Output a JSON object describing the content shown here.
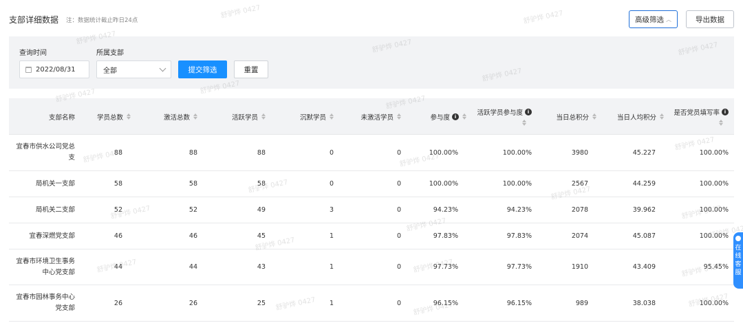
{
  "header": {
    "title": "支部详细数据",
    "note": "注：数据统计截止昨日24点",
    "advanced_filter_label": "高级筛选",
    "export_label": "导出数据"
  },
  "filter": {
    "time_label": "查询时间",
    "date_value": "2022/08/31",
    "branch_label": "所属支部",
    "branch_value": "全部",
    "submit_label": "提交筛选",
    "reset_label": "重置"
  },
  "table": {
    "columns": [
      {
        "label": "支部名称"
      },
      {
        "label": "学员总数"
      },
      {
        "label": "激活总数"
      },
      {
        "label": "活跃学员"
      },
      {
        "label": "沉默学员"
      },
      {
        "label": "未激活学员"
      },
      {
        "label": "参与度"
      },
      {
        "label": "活跃学员参与度"
      },
      {
        "label": "当日总积分"
      },
      {
        "label": "当日人均积分"
      },
      {
        "label": "是否党员填写率"
      }
    ],
    "rows": [
      {
        "name": "宜春市供水公司党总支",
        "cells": [
          "88",
          "88",
          "88",
          "0",
          "0",
          "100.00%",
          "100.00%",
          "3980",
          "45.227",
          "100.00%"
        ]
      },
      {
        "name": "局机关一支部",
        "cells": [
          "58",
          "58",
          "58",
          "0",
          "0",
          "100.00%",
          "100.00%",
          "2567",
          "44.259",
          "100.00%"
        ]
      },
      {
        "name": "局机关二支部",
        "cells": [
          "52",
          "52",
          "49",
          "3",
          "0",
          "94.23%",
          "94.23%",
          "2078",
          "39.962",
          "100.00%"
        ]
      },
      {
        "name": "宜春深燃党支部",
        "cells": [
          "46",
          "46",
          "45",
          "1",
          "0",
          "97.83%",
          "97.83%",
          "2074",
          "45.087",
          "100.00%"
        ]
      },
      {
        "name": "宜春市环境卫生事务中心党支部",
        "cells": [
          "44",
          "44",
          "43",
          "1",
          "0",
          "97.73%",
          "97.73%",
          "1910",
          "43.409",
          "95.45%"
        ]
      },
      {
        "name": "宜春市园林事务中心党支部",
        "cells": [
          "26",
          "26",
          "25",
          "1",
          "0",
          "96.15%",
          "96.15%",
          "989",
          "38.038",
          "100.00%"
        ]
      }
    ]
  },
  "watermark": "舒驴烨 0427",
  "float_service": {
    "chars": [
      "在",
      "线",
      "客",
      "服"
    ]
  }
}
